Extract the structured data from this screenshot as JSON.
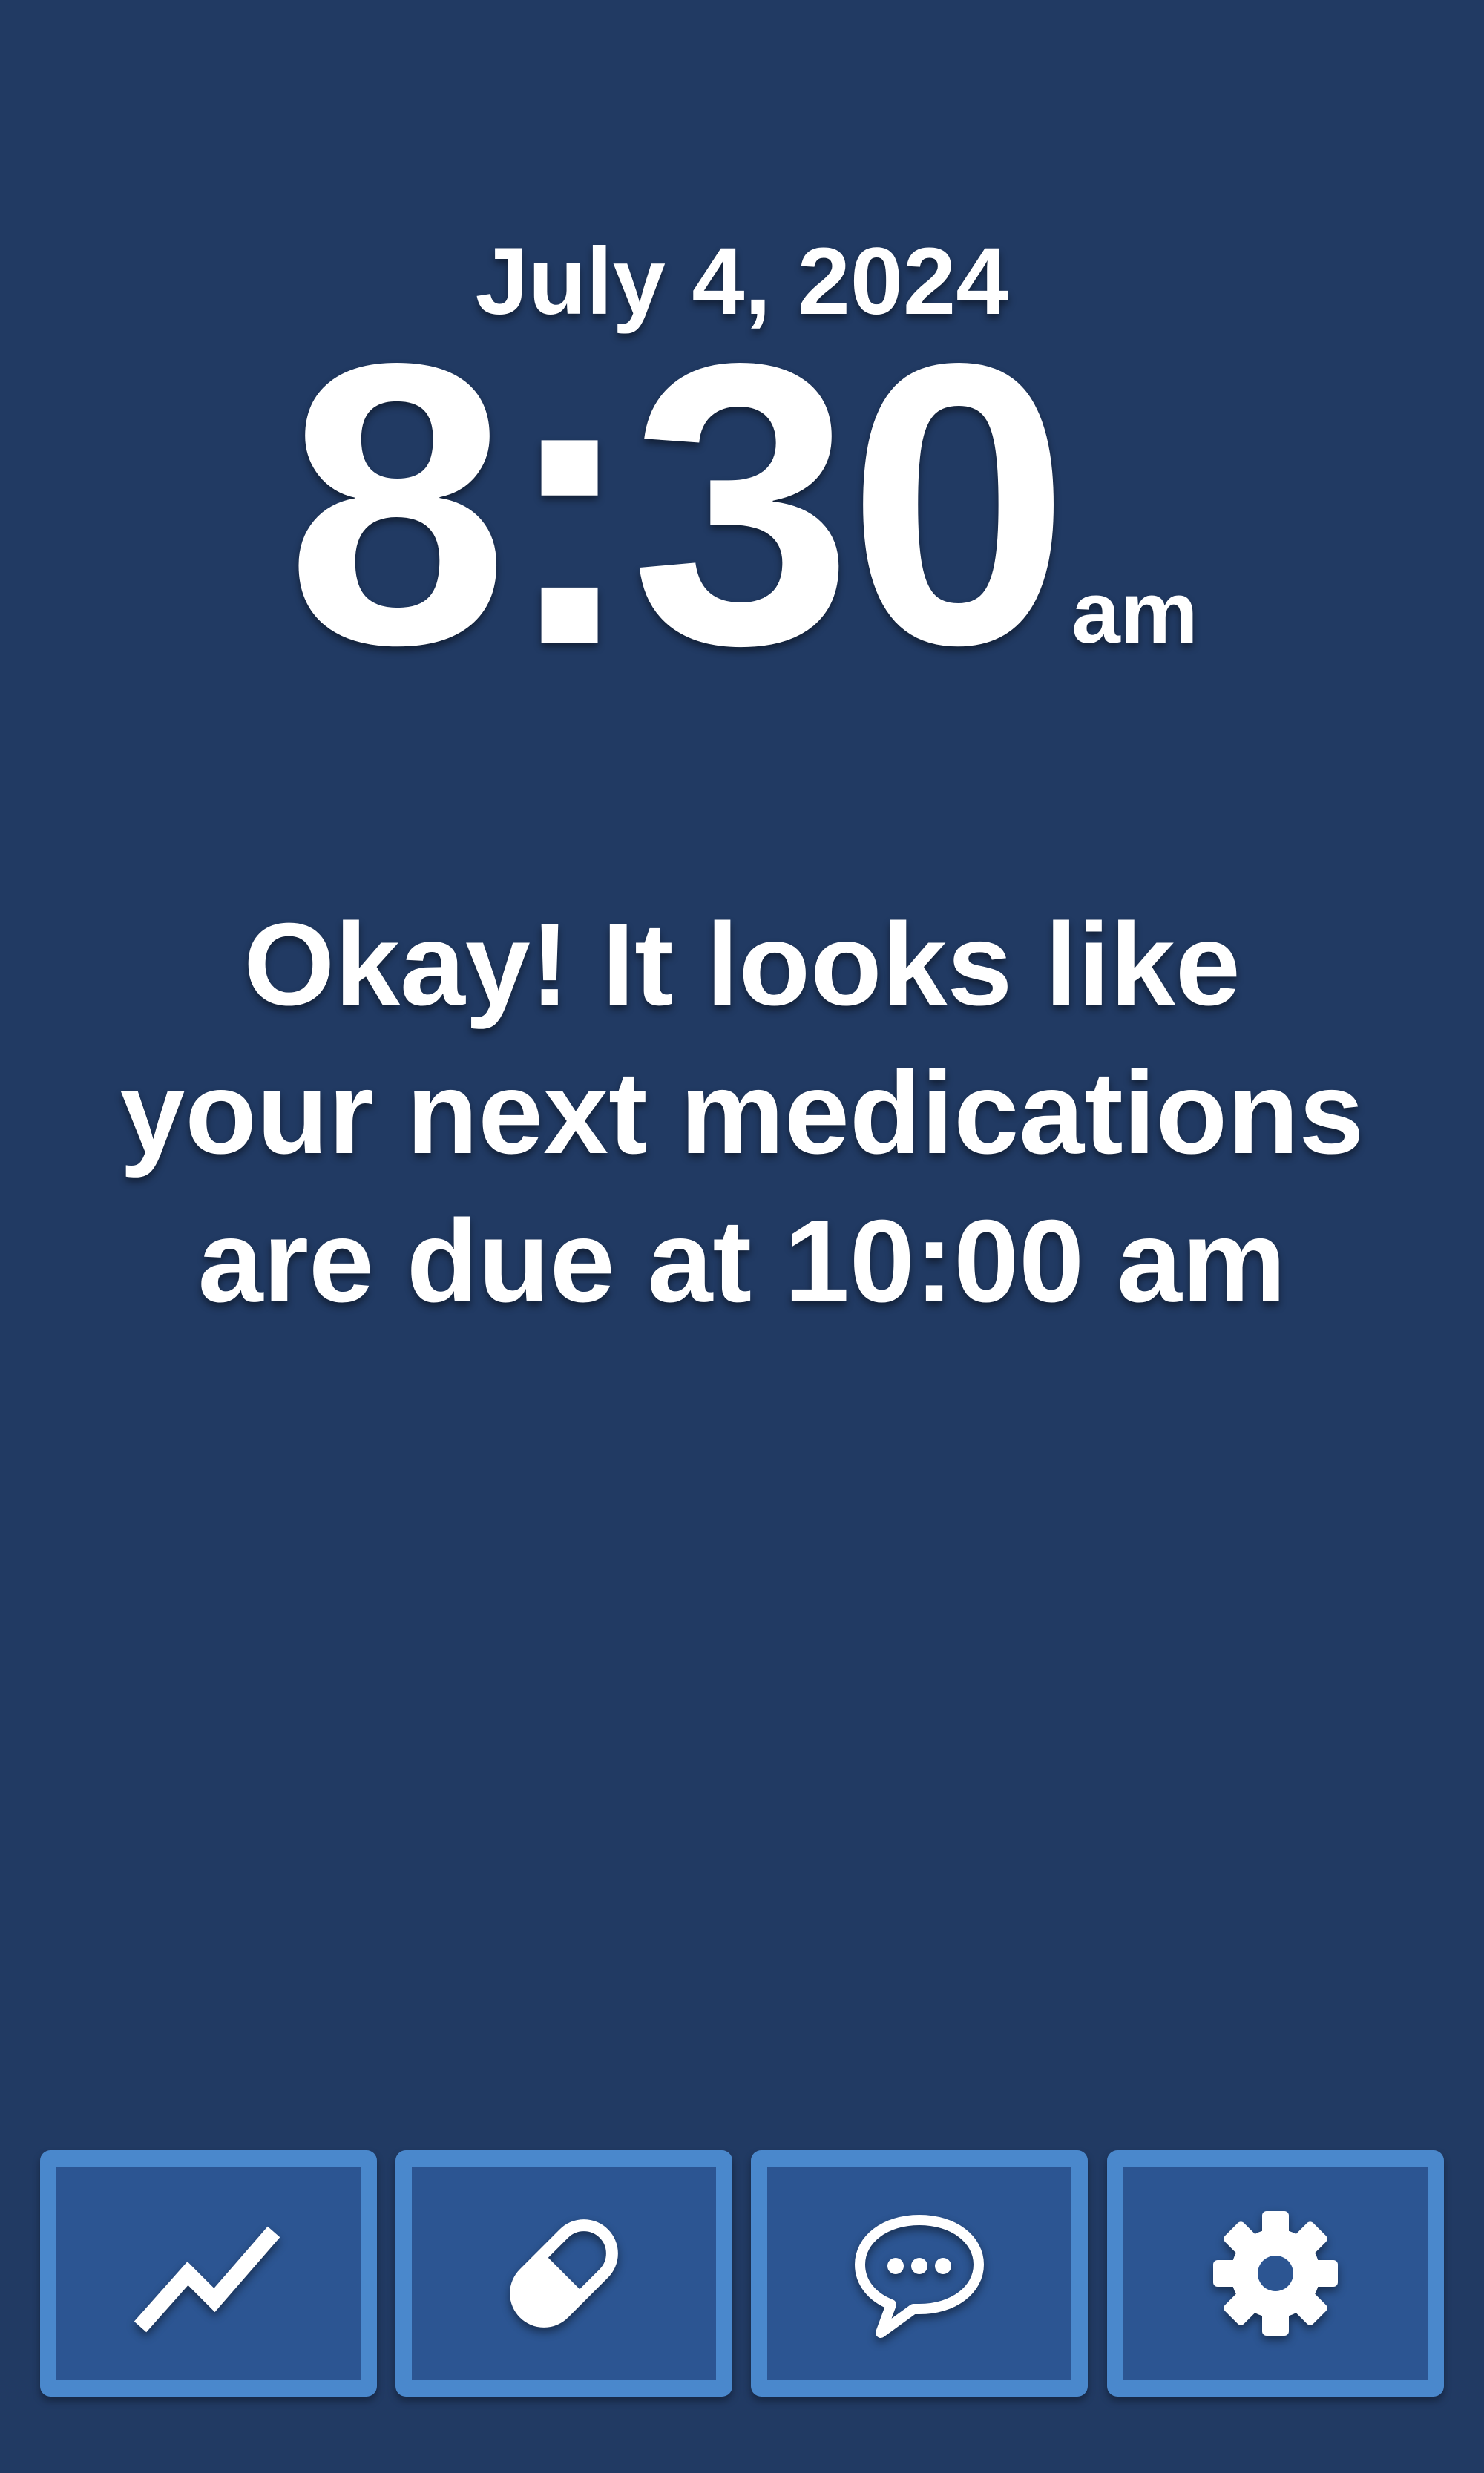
{
  "header": {
    "date": "July 4, 2024",
    "time": "8:30",
    "period": "am"
  },
  "message": {
    "lines": [
      "Okay! It looks like",
      "your next medications",
      "are due at 10:00 am"
    ]
  },
  "nav": {
    "items": [
      {
        "icon": "trend-line-icon"
      },
      {
        "icon": "pill-icon"
      },
      {
        "icon": "chat-bubble-icon"
      },
      {
        "icon": "gear-icon"
      }
    ]
  },
  "colors": {
    "background": "#213a63",
    "button_fill": "#2c5592",
    "button_border": "#4a88cc",
    "text": "#ffffff"
  }
}
